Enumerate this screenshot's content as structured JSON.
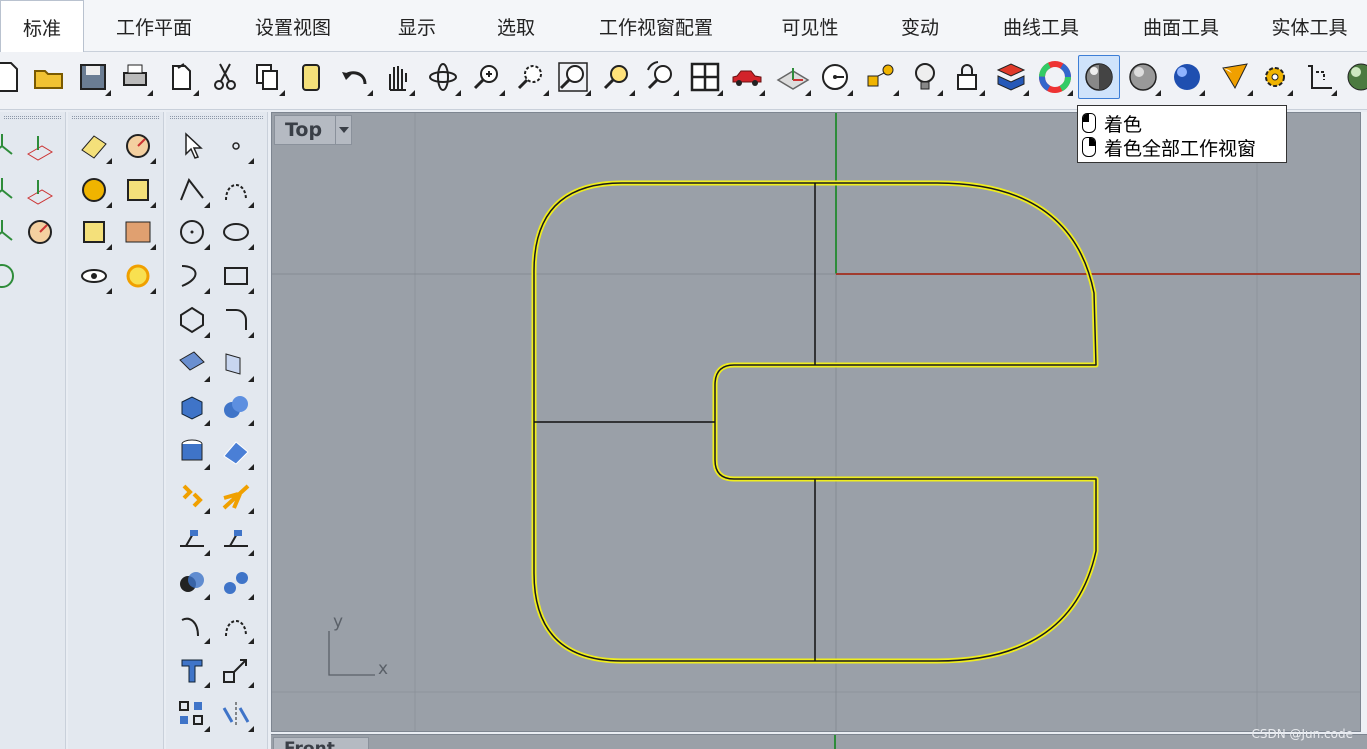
{
  "tabs": [
    "标准",
    "工作平面",
    "设置视图",
    "显示",
    "选取",
    "工作视窗配置",
    "可见性",
    "变动",
    "曲线工具",
    "曲面工具",
    "实体工具"
  ],
  "active_tab": "标准",
  "toolbar_icons": [
    "new-file-icon",
    "open-folder-icon",
    "save-icon",
    "print-icon",
    "import-icon",
    "cut-icon",
    "copy-icon",
    "paste-icon",
    "undo-icon",
    "pan-hand-icon",
    "rotate-view-icon",
    "zoom-dynamic-icon",
    "zoom-window-icon",
    "zoom-extents-icon",
    "zoom-selected-icon",
    "undo-view-icon",
    "four-viewports-icon",
    "car-model-icon",
    "set-cplane-icon",
    "distance-icon",
    "layer-objects-icon",
    "lightbulb-icon",
    "lock-icon",
    "layer-color-icon",
    "color-wheel-icon",
    "shaded-icon",
    "ghosted-icon",
    "render-sphere-icon",
    "render-cone-icon",
    "options-gear-icon",
    "dimension-icon",
    "sphere-extra-icon"
  ],
  "tooltip": {
    "left_click": "着色",
    "right_click": "着色全部工作视窗"
  },
  "viewport": {
    "title": "Top",
    "axis_y": "y",
    "axis_x": "x"
  },
  "viewport2": {
    "title": "Front"
  },
  "watermark": "CSDN @Jun.code",
  "colors": {
    "viewport_bg": "#9aa0a8",
    "curve_highlight": "#f0ee1e",
    "x_axis": "#a13b2e",
    "y_axis": "#2e8c3a",
    "grid": "#8d939b"
  }
}
